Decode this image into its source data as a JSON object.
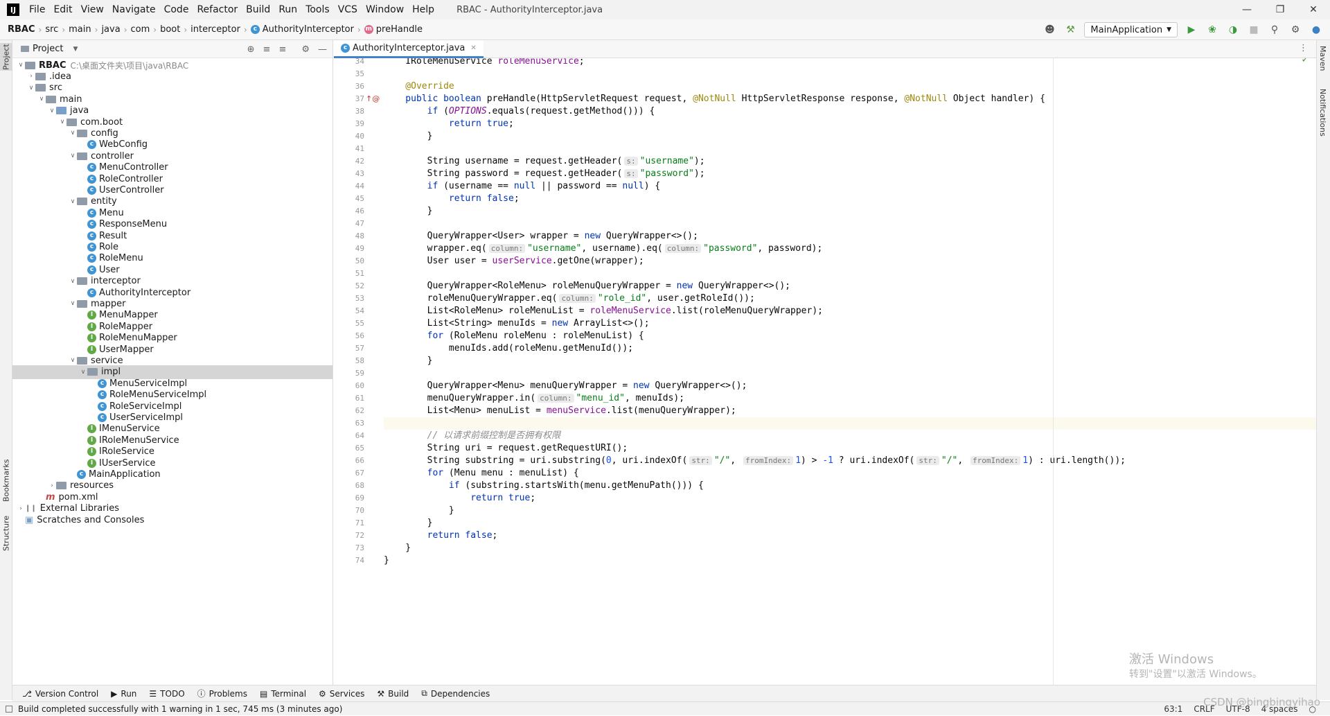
{
  "menubar": {
    "items": [
      "File",
      "Edit",
      "View",
      "Navigate",
      "Code",
      "Refactor",
      "Build",
      "Run",
      "Tools",
      "VCS",
      "Window",
      "Help"
    ],
    "title": "RBAC - AuthorityInterceptor.java"
  },
  "breadcrumb": {
    "items": [
      "RBAC",
      "src",
      "main",
      "java",
      "com",
      "boot",
      "interceptor",
      "AuthorityInterceptor",
      "preHandle"
    ]
  },
  "run_config": "MainApplication",
  "project_panel": {
    "title": "Project"
  },
  "tree": [
    {
      "label": "RBAC",
      "extra": "C:\\桌面文件夹\\项目\\java\\RBAC",
      "depth": 0,
      "type": "module",
      "open": true
    },
    {
      "label": ".idea",
      "depth": 1,
      "type": "folder",
      "open": false
    },
    {
      "label": "src",
      "depth": 1,
      "type": "folder",
      "open": true
    },
    {
      "label": "main",
      "depth": 2,
      "type": "folder",
      "open": true
    },
    {
      "label": "java",
      "depth": 3,
      "type": "src",
      "open": true
    },
    {
      "label": "com.boot",
      "depth": 4,
      "type": "folder",
      "open": true
    },
    {
      "label": "config",
      "depth": 5,
      "type": "folder",
      "open": true
    },
    {
      "label": "WebConfig",
      "depth": 6,
      "type": "class"
    },
    {
      "label": "controller",
      "depth": 5,
      "type": "folder",
      "open": true
    },
    {
      "label": "MenuController",
      "depth": 6,
      "type": "class"
    },
    {
      "label": "RoleController",
      "depth": 6,
      "type": "class"
    },
    {
      "label": "UserController",
      "depth": 6,
      "type": "class"
    },
    {
      "label": "entity",
      "depth": 5,
      "type": "folder",
      "open": true
    },
    {
      "label": "Menu",
      "depth": 6,
      "type": "class"
    },
    {
      "label": "ResponseMenu",
      "depth": 6,
      "type": "class"
    },
    {
      "label": "Result",
      "depth": 6,
      "type": "class"
    },
    {
      "label": "Role",
      "depth": 6,
      "type": "class"
    },
    {
      "label": "RoleMenu",
      "depth": 6,
      "type": "class"
    },
    {
      "label": "User",
      "depth": 6,
      "type": "class"
    },
    {
      "label": "interceptor",
      "depth": 5,
      "type": "folder",
      "open": true
    },
    {
      "label": "AuthorityInterceptor",
      "depth": 6,
      "type": "class"
    },
    {
      "label": "mapper",
      "depth": 5,
      "type": "folder",
      "open": true
    },
    {
      "label": "MenuMapper",
      "depth": 6,
      "type": "interface"
    },
    {
      "label": "RoleMapper",
      "depth": 6,
      "type": "interface"
    },
    {
      "label": "RoleMenuMapper",
      "depth": 6,
      "type": "interface"
    },
    {
      "label": "UserMapper",
      "depth": 6,
      "type": "interface"
    },
    {
      "label": "service",
      "depth": 5,
      "type": "folder",
      "open": true
    },
    {
      "label": "impl",
      "depth": 6,
      "type": "folder",
      "open": true,
      "selected": true
    },
    {
      "label": "MenuServiceImpl",
      "depth": 7,
      "type": "class"
    },
    {
      "label": "RoleMenuServiceImpl",
      "depth": 7,
      "type": "class"
    },
    {
      "label": "RoleServiceImpl",
      "depth": 7,
      "type": "class"
    },
    {
      "label": "UserServiceImpl",
      "depth": 7,
      "type": "class"
    },
    {
      "label": "IMenuService",
      "depth": 6,
      "type": "interface"
    },
    {
      "label": "IRoleMenuService",
      "depth": 6,
      "type": "interface"
    },
    {
      "label": "IRoleService",
      "depth": 6,
      "type": "interface"
    },
    {
      "label": "IUserService",
      "depth": 6,
      "type": "interface"
    },
    {
      "label": "MainApplication",
      "depth": 5,
      "type": "class"
    },
    {
      "label": "resources",
      "depth": 3,
      "type": "folder",
      "open": false
    },
    {
      "label": "pom.xml",
      "depth": 2,
      "type": "file"
    },
    {
      "label": "External Libraries",
      "depth": 0,
      "type": "lib",
      "open": false
    },
    {
      "label": "Scratches and Consoles",
      "depth": 0,
      "type": "scratch"
    }
  ],
  "editor": {
    "tab": "AuthorityInterceptor.java",
    "current_line": "63",
    "lines": [
      [
        "34",
        [
          [
            "",
            "    IRoleMenuService "
          ],
          [
            "fld",
            "roleMenuService"
          ],
          [
            "",
            ";"
          ]
        ]
      ],
      [
        "35",
        []
      ],
      [
        "36",
        [
          [
            "ann",
            "    @Override"
          ]
        ]
      ],
      [
        "37",
        [
          [
            "kw",
            "    public boolean "
          ],
          [
            "",
            "preHandle(HttpServletRequest request, "
          ],
          [
            "ann",
            "@NotNull"
          ],
          [
            "",
            " HttpServletResponse response, "
          ],
          [
            "ann",
            "@NotNull"
          ],
          [
            "",
            " Object handler) {"
          ]
        ]
      ],
      [
        "38",
        [
          [
            "kw",
            "        if "
          ],
          [
            "",
            "("
          ],
          [
            "ital",
            "OPTIONS"
          ],
          [
            "",
            ".equals(request.getMethod())) {"
          ]
        ]
      ],
      [
        "39",
        [
          [
            "kw",
            "            return true"
          ],
          [
            "",
            ";"
          ]
        ]
      ],
      [
        "40",
        [
          [
            "",
            "        }"
          ]
        ]
      ],
      [
        "41",
        []
      ],
      [
        "42",
        [
          [
            "",
            "        String username = request.getHeader("
          ],
          [
            "hint",
            "s:"
          ],
          [
            "str",
            "\"username\""
          ],
          [
            "",
            ");"
          ]
        ]
      ],
      [
        "43",
        [
          [
            "",
            "        String password = request.getHeader("
          ],
          [
            "hint",
            "s:"
          ],
          [
            "str",
            "\"password\""
          ],
          [
            "",
            ");"
          ]
        ]
      ],
      [
        "44",
        [
          [
            "kw",
            "        if "
          ],
          [
            "",
            "(username == "
          ],
          [
            "kw",
            "null"
          ],
          [
            "",
            " || password == "
          ],
          [
            "kw",
            "null"
          ],
          [
            "",
            ") {"
          ]
        ]
      ],
      [
        "45",
        [
          [
            "kw",
            "            return false"
          ],
          [
            "",
            ";"
          ]
        ]
      ],
      [
        "46",
        [
          [
            "",
            "        }"
          ]
        ]
      ],
      [
        "47",
        []
      ],
      [
        "48",
        [
          [
            "",
            "        QueryWrapper<User> wrapper = "
          ],
          [
            "kw",
            "new "
          ],
          [
            "",
            "QueryWrapper<>();"
          ]
        ]
      ],
      [
        "49",
        [
          [
            "",
            "        wrapper.eq("
          ],
          [
            "hint",
            "column:"
          ],
          [
            "str",
            "\"username\""
          ],
          [
            "",
            ", username).eq("
          ],
          [
            "hint",
            "column:"
          ],
          [
            "str",
            "\"password\""
          ],
          [
            "",
            ", password);"
          ]
        ]
      ],
      [
        "50",
        [
          [
            "",
            "        User user = "
          ],
          [
            "fld",
            "userService"
          ],
          [
            "",
            ".getOne(wrapper);"
          ]
        ]
      ],
      [
        "51",
        []
      ],
      [
        "52",
        [
          [
            "",
            "        QueryWrapper<RoleMenu> roleMenuQueryWrapper = "
          ],
          [
            "kw",
            "new "
          ],
          [
            "",
            "QueryWrapper<>();"
          ]
        ]
      ],
      [
        "53",
        [
          [
            "",
            "        roleMenuQueryWrapper.eq("
          ],
          [
            "hint",
            "column:"
          ],
          [
            "str",
            "\"role_id\""
          ],
          [
            "",
            ", user.getRoleId());"
          ]
        ]
      ],
      [
        "54",
        [
          [
            "",
            "        List<RoleMenu> roleMenuList = "
          ],
          [
            "fld",
            "roleMenuService"
          ],
          [
            "",
            ".list(roleMenuQueryWrapper);"
          ]
        ]
      ],
      [
        "55",
        [
          [
            "",
            "        List<String> menuIds = "
          ],
          [
            "kw",
            "new "
          ],
          [
            "",
            "ArrayList<>();"
          ]
        ]
      ],
      [
        "56",
        [
          [
            "kw",
            "        for "
          ],
          [
            "",
            "(RoleMenu roleMenu : roleMenuList) {"
          ]
        ]
      ],
      [
        "57",
        [
          [
            "",
            "            menuIds.add(roleMenu.getMenuId());"
          ]
        ]
      ],
      [
        "58",
        [
          [
            "",
            "        }"
          ]
        ]
      ],
      [
        "59",
        []
      ],
      [
        "60",
        [
          [
            "",
            "        QueryWrapper<Menu> menuQueryWrapper = "
          ],
          [
            "kw",
            "new "
          ],
          [
            "",
            "QueryWrapper<>();"
          ]
        ]
      ],
      [
        "61",
        [
          [
            "",
            "        menuQueryWrapper.in("
          ],
          [
            "hint",
            "column:"
          ],
          [
            "str",
            "\"menu_id\""
          ],
          [
            "",
            ", menuIds);"
          ]
        ]
      ],
      [
        "62",
        [
          [
            "",
            "        List<Menu> menuList = "
          ],
          [
            "fld",
            "menuService"
          ],
          [
            "",
            ".list(menuQueryWrapper);"
          ]
        ]
      ],
      [
        "63",
        []
      ],
      [
        "64",
        [
          [
            "cmt",
            "        // 以请求前缀控制是否拥有权限"
          ]
        ]
      ],
      [
        "65",
        [
          [
            "",
            "        String uri = request.getRequestURI();"
          ]
        ]
      ],
      [
        "66",
        [
          [
            "",
            "        String substring = uri.substring("
          ],
          [
            "num",
            "0"
          ],
          [
            "",
            ", uri.indexOf("
          ],
          [
            "hint",
            "str:"
          ],
          [
            "str",
            "\"/\""
          ],
          [
            "",
            ", "
          ],
          [
            "hint",
            "fromIndex:"
          ],
          [
            "num",
            "1"
          ],
          [
            "",
            ") > "
          ],
          [
            "num",
            "-1"
          ],
          [
            "",
            " ? uri.indexOf("
          ],
          [
            "hint",
            "str:"
          ],
          [
            "str",
            "\"/\""
          ],
          [
            "",
            ", "
          ],
          [
            "hint",
            "fromIndex:"
          ],
          [
            "num",
            "1"
          ],
          [
            "",
            ") : uri.length());"
          ]
        ]
      ],
      [
        "67",
        [
          [
            "kw",
            "        for "
          ],
          [
            "",
            "(Menu menu : menuList) {"
          ]
        ]
      ],
      [
        "68",
        [
          [
            "kw",
            "            if "
          ],
          [
            "",
            "(substring.startsWith(menu.getMenuPath())) {"
          ]
        ]
      ],
      [
        "69",
        [
          [
            "kw",
            "                return true"
          ],
          [
            "",
            ";"
          ]
        ]
      ],
      [
        "70",
        [
          [
            "",
            "            }"
          ]
        ]
      ],
      [
        "71",
        [
          [
            "",
            "        }"
          ]
        ]
      ],
      [
        "72",
        [
          [
            "kw",
            "        return false"
          ],
          [
            "",
            ";"
          ]
        ]
      ],
      [
        "73",
        [
          [
            "",
            "    }"
          ]
        ]
      ],
      [
        "74",
        [
          [
            "",
            "}"
          ]
        ]
      ]
    ]
  },
  "watermark": {
    "line1": "激活 Windows",
    "line2": "转到\"设置\"以激活 Windows。"
  },
  "side_tabs": {
    "project": "Project",
    "bookmarks": "Bookmarks",
    "structure": "Structure",
    "maven": "Maven",
    "notifications": "Notifications"
  },
  "toolwindows": [
    "Version Control",
    "Run",
    "TODO",
    "Problems",
    "Terminal",
    "Services",
    "Build",
    "Dependencies"
  ],
  "status": {
    "message": "Build completed successfully with 1 warning in 1 sec, 745 ms (3 minutes ago)",
    "position": "63:1",
    "line_sep": "CRLF",
    "encoding": "UTF-8",
    "indent": "4 spaces"
  },
  "csdn": "CSDN @bingbingyihao"
}
